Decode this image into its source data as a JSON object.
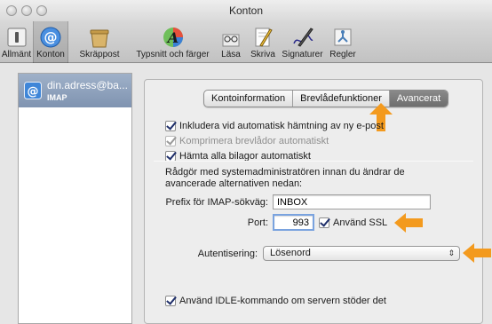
{
  "window": {
    "title": "Konton"
  },
  "toolbar": {
    "items": [
      {
        "label": "Allmänt",
        "icon": "switch-icon"
      },
      {
        "label": "Konton",
        "icon": "at-sign-icon"
      },
      {
        "label": "Skräppost",
        "icon": "trash-bin-icon"
      },
      {
        "label": "Typsnitt och färger",
        "icon": "font-color-icon"
      },
      {
        "label": "Läsa",
        "icon": "glasses-icon"
      },
      {
        "label": "Skriva",
        "icon": "pencil-note-icon"
      },
      {
        "label": "Signaturer",
        "icon": "signature-pen-icon"
      },
      {
        "label": "Regler",
        "icon": "rules-icon"
      }
    ],
    "active": "Konton"
  },
  "account": {
    "name": "din.adress@ba...",
    "type": "IMAP"
  },
  "tabs": [
    "Kontoinformation",
    "Brevlådefunktioner",
    "Avancerat"
  ],
  "selected_tab": "Avancerat",
  "options": {
    "include_check": "Inkludera vid automatisk hämtning av ny e-post",
    "compact": "Komprimera brevlådor automatiskt",
    "download_attachments": "Hämta alla bilagor automatiskt",
    "idle": "Använd IDLE-kommando om servern stöder det"
  },
  "info_text": "Rådgör med systemadministratören innan du ändrar de avancerade alternativen nedan:",
  "imap_prefix": {
    "label": "Prefix för IMAP-sökväg:",
    "value": "INBOX"
  },
  "port": {
    "label": "Port:",
    "value": "993"
  },
  "ssl": {
    "label": "Använd SSL"
  },
  "auth": {
    "label": "Autentisering:",
    "value": "Lösenord"
  },
  "colors": {
    "accent_arrow": "#f39a1e",
    "selection": "#8597b3"
  }
}
